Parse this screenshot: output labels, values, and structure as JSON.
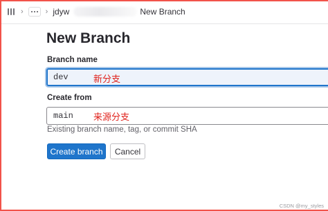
{
  "breadcrumb": {
    "project": "jdyw",
    "current": "New Branch"
  },
  "page": {
    "title": "New Branch"
  },
  "form": {
    "branch_name": {
      "label": "Branch name",
      "value": "dev",
      "annotation": "新分支"
    },
    "create_from": {
      "label": "Create from",
      "value": "main",
      "annotation": "来源分支",
      "hint": "Existing branch name, tag, or commit SHA"
    }
  },
  "buttons": {
    "create": "Create branch",
    "cancel": "Cancel"
  },
  "watermark": "CSDN @my_styles",
  "colors": {
    "accent": "#1f75cb",
    "annotation": "#e0211b",
    "frame": "#f2534a"
  }
}
